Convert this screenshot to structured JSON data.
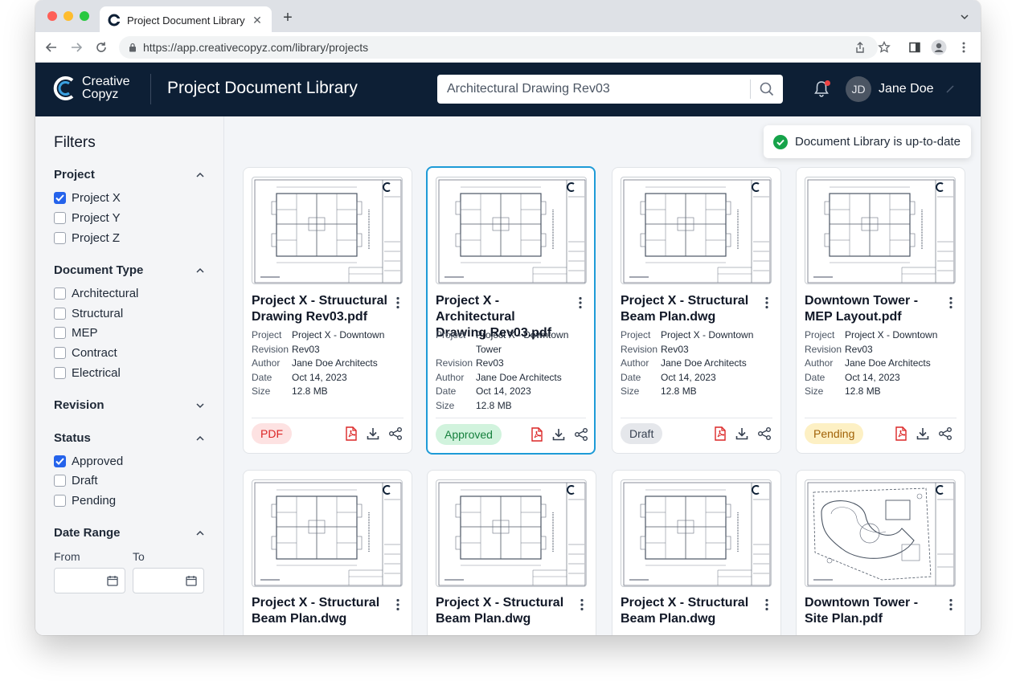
{
  "browser": {
    "tab_title": "Project Document Library",
    "url": "https://app.creativecopyz.com/library/projects"
  },
  "header": {
    "logo_line1": "Creative",
    "logo_line2": "Copyz",
    "title": "Project Document Library",
    "search_value": "Architectural Drawing Rev03",
    "user_initials": "JD",
    "user_name": "Jane Doe"
  },
  "sidebar": {
    "title": "Filters",
    "project": {
      "heading": "Project",
      "options": [
        "Project X",
        "Project Y",
        "Project Z"
      ]
    },
    "doctype": {
      "heading": "Document Type",
      "options": [
        "Architectural",
        "Structural",
        "MEP",
        "Contract",
        "Electrical"
      ]
    },
    "revision": {
      "heading": "Revision"
    },
    "status": {
      "heading": "Status",
      "options": [
        "Approved",
        "Draft",
        "Pending"
      ]
    },
    "date": {
      "heading": "Date Range",
      "from": "From",
      "to": "To"
    }
  },
  "toast": {
    "text": "Document Library is up-to-date"
  },
  "labels": {
    "project": "Project",
    "revision": "Revision",
    "author": "Author",
    "date": "Date",
    "size": "Size"
  },
  "cards": [
    {
      "title_l1": "Project X - Struuctural",
      "title_l2": "Drawing Rev03.pdf",
      "project": "Project X - Downtown",
      "revision": "Rev03",
      "author": "Jane Doe Architects",
      "date": "Oct 14, 2023",
      "size": "12.8 MB",
      "badge": "PDF"
    },
    {
      "title_l1": "Project X - Architectural",
      "title_l2": "Drawing Rev03.pdf",
      "project": "Project X - Downtown",
      "project_l2": "Tower",
      "revision": "Rev03",
      "author": "Jane Doe Architects",
      "date": "Oct 14, 2023",
      "size": "12.8 MB",
      "badge": "Approved"
    },
    {
      "title_l1": "Project X - Structural",
      "title_l2": "Beam Plan.dwg",
      "project": "Project X - Downtown",
      "revision": "Rev03",
      "author": "Jane Doe Architects",
      "date": "Oct 14, 2023",
      "size": "12.8 MB",
      "badge": "Draft"
    },
    {
      "title_l1": "Downtown Tower -",
      "title_l2": "MEP Layout.pdf",
      "project": "Project X - Downtown",
      "revision": "Rev03",
      "author": "Jane Doe Architects",
      "date": "Oct 14, 2023",
      "size": "12.8 MB",
      "badge": "Pending"
    },
    {
      "title_l1": "Project X - Structural",
      "title_l2": "Beam Plan.dwg"
    },
    {
      "title_l1": "Project X - Structural",
      "title_l2": "Beam Plan.dwg"
    },
    {
      "title_l1": "Project X - Structural",
      "title_l2": "Beam Plan.dwg"
    },
    {
      "title_l1": "Downtown Tower -",
      "title_l2": "Site Plan.pdf"
    }
  ]
}
